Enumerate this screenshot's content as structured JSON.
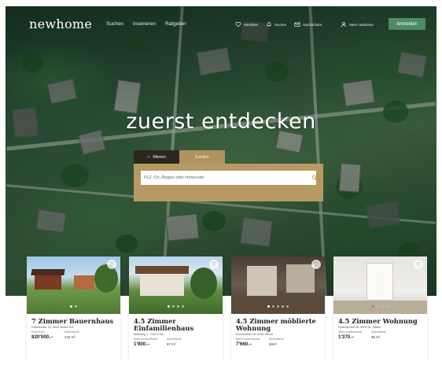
{
  "header": {
    "logo": "newhome",
    "nav_links": [
      "Suchen",
      "Inserieren",
      "Ratgeber"
    ],
    "nav_icons": [
      {
        "label": "Merkliste",
        "icon": "heart-icon"
      },
      {
        "label": "Suchen",
        "icon": "bell-icon"
      },
      {
        "label": "Nachrichten",
        "icon": "mail-icon"
      },
      {
        "label": "Mein newhome",
        "icon": "user-icon"
      }
    ],
    "login_label": "Anmelden"
  },
  "hero": {
    "headline": "zuerst entdecken"
  },
  "search": {
    "tabs": [
      {
        "label": "Mieten",
        "active": true
      },
      {
        "label": "Kaufen",
        "active": false
      }
    ],
    "placeholder": "PLZ, Ort, Region oder Immocode"
  },
  "listings": [
    {
      "title": "7 Zimmer Bauernhaus",
      "address": "Dorfstrasse 15, 9000 Nollen AG",
      "label_left": "Preis EUR",
      "label_right": "Wohnfläche",
      "value_left": "820'000.–",
      "value_right": "242 m²"
    },
    {
      "title": "4.5 Zimmer Einfamilienhaus",
      "address": "Mühlweg 7, 7000 Chur",
      "label_left": "Miete brutto/Monat",
      "label_right": "Wohnfläche",
      "value_left": "1'900.–",
      "value_right": "87 m²"
    },
    {
      "title": "4.5 Zimmer möblierte Wohnung",
      "address": "Bornweisstr 15, 8002 Zürich",
      "label_left": "Miete brutto/Monat",
      "label_right": "Wohnfläche",
      "value_left": "7'660.–",
      "value_right": "96m²"
    },
    {
      "title": "4.5 Zimmer Wohnung",
      "address": "Hinterdorfstr 26, 9000 St. Gallen",
      "label_left": "Miete brutto/Monat",
      "label_right": "Wohnfläche",
      "value_left": "1'370.–",
      "value_right": "95 m²"
    }
  ],
  "colors": {
    "accent_green": "#4d8a66",
    "search_gold": "#b79a63",
    "tab_dark": "#2a2622"
  }
}
